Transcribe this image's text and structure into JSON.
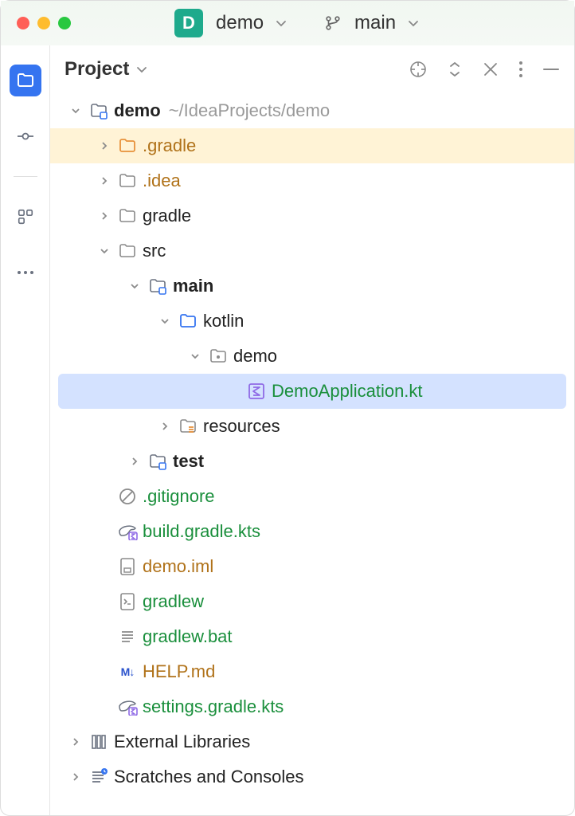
{
  "titlebar": {
    "project_badge": "D",
    "project_name": "demo",
    "branch_name": "main"
  },
  "panel": {
    "title": "Project"
  },
  "tree": {
    "root": {
      "name": "demo",
      "path": "~/IdeaProjects/demo"
    },
    "items": [
      {
        "name": ".gradle",
        "color": "orange"
      },
      {
        "name": ".idea",
        "color": "orange"
      },
      {
        "name": "gradle"
      },
      {
        "name": "src"
      },
      {
        "name": "main"
      },
      {
        "name": "kotlin"
      },
      {
        "name": "demo"
      },
      {
        "name": "DemoApplication.kt",
        "color": "green"
      },
      {
        "name": "resources"
      },
      {
        "name": "test"
      },
      {
        "name": ".gitignore",
        "color": "green"
      },
      {
        "name": "build.gradle.kts",
        "color": "green"
      },
      {
        "name": "demo.iml",
        "color": "orange"
      },
      {
        "name": "gradlew",
        "color": "green"
      },
      {
        "name": "gradlew.bat",
        "color": "green"
      },
      {
        "name": "HELP.md",
        "color": "orange"
      },
      {
        "name": "settings.gradle.kts",
        "color": "green"
      },
      {
        "name": "External Libraries"
      },
      {
        "name": "Scratches and Consoles"
      }
    ]
  }
}
